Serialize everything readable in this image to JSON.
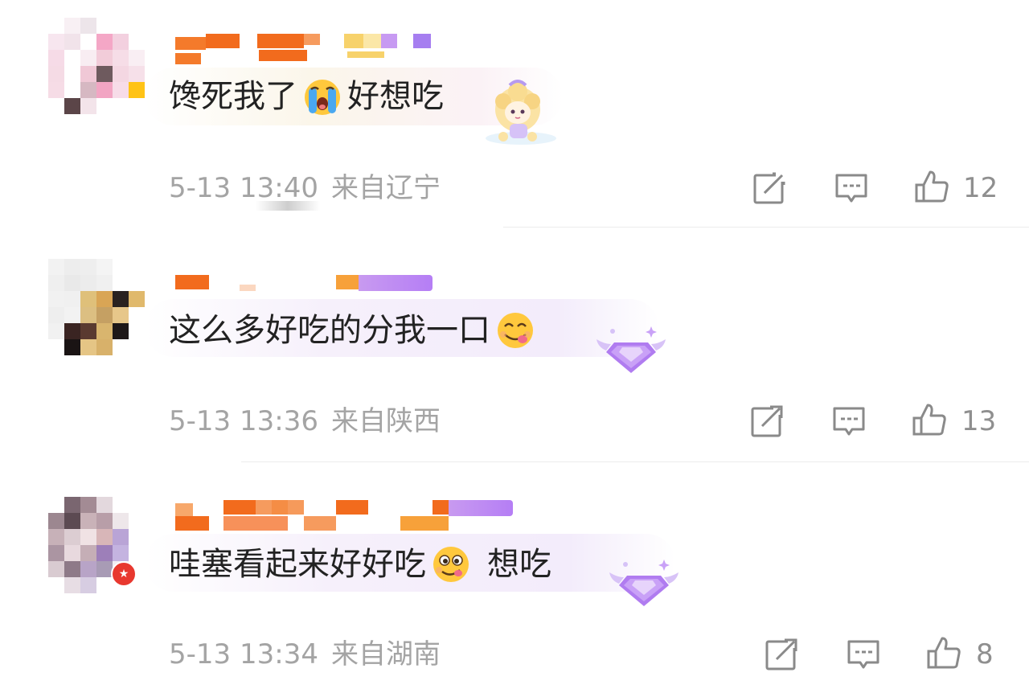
{
  "comments": [
    {
      "text_before": "馋死我了",
      "emoji_mid": "crying-face",
      "text_after": "好想吃",
      "date": "5-13 13:40",
      "location": "来自辽宁",
      "likes": "12",
      "decoration": "cartoon-girl-sticker"
    },
    {
      "text_before": "这么多好吃的分我一口",
      "emoji_mid": "yum-face",
      "text_after": "",
      "date": "5-13 13:36",
      "location": "来自陕西",
      "likes": "13",
      "decoration": "purple-diamond-badge"
    },
    {
      "text_before": "哇塞看起来好好吃",
      "emoji_mid": "drooling-face",
      "text_after": "想吃",
      "date": "5-13 13:34",
      "location": "来自湖南",
      "likes": "8",
      "decoration": "purple-diamond-badge"
    }
  ],
  "icons": {
    "share": "share-icon",
    "comment": "comment-icon",
    "like": "thumbs-up-icon"
  },
  "colors": {
    "username_orange": "#f26b1d",
    "tag_purple": "#b57ef5",
    "text_main": "#222222",
    "text_meta": "#a4a4a4"
  }
}
